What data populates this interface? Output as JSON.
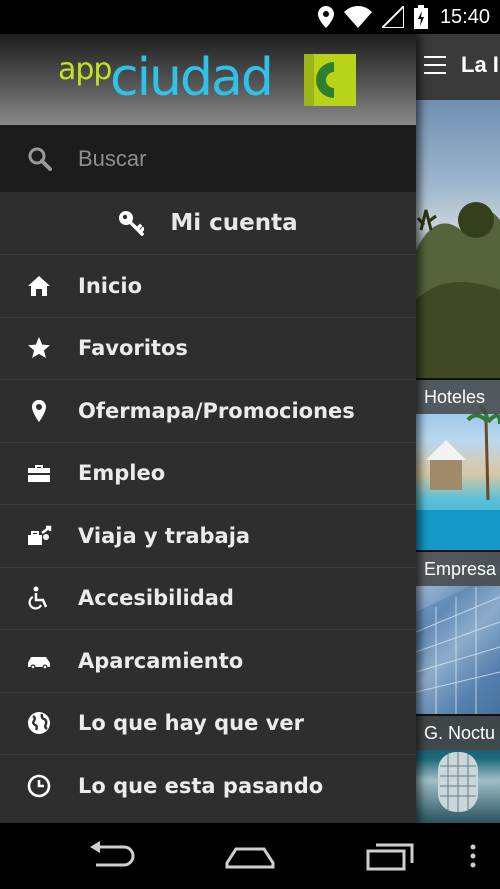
{
  "status_bar": {
    "time": "15:40",
    "icons": [
      "location-icon",
      "wifi-icon",
      "signal-icon",
      "battery-icon"
    ]
  },
  "drawer": {
    "logo": {
      "app": "app",
      "ciudad": "ciudad"
    },
    "search": {
      "placeholder": "Buscar"
    },
    "account": {
      "label": "Mi cuenta",
      "icon": "key-icon"
    },
    "items": [
      {
        "label": "Inicio",
        "icon": "home-icon"
      },
      {
        "label": "Favoritos",
        "icon": "star-icon"
      },
      {
        "label": "Ofermapa/Promociones",
        "icon": "map-pin-icon"
      },
      {
        "label": "Empleo",
        "icon": "briefcase-icon"
      },
      {
        "label": "Viaja y trabaja",
        "icon": "luggage-icon"
      },
      {
        "label": "Accesibilidad",
        "icon": "wheelchair-icon"
      },
      {
        "label": "Aparcamiento",
        "icon": "car-icon"
      },
      {
        "label": "Lo que hay que ver",
        "icon": "globe-icon"
      },
      {
        "label": "Lo que esta pasando",
        "icon": "clock-icon"
      }
    ]
  },
  "main": {
    "title": "La I",
    "tiles": [
      "Hoteles",
      "Empresa",
      "G. Noctu"
    ]
  },
  "colors": {
    "logo_app": "#c8e01f",
    "logo_ciudad": "#2ec3e6",
    "drawer_bg": "#2e2e2e",
    "search_bg": "#1c1c1c"
  }
}
